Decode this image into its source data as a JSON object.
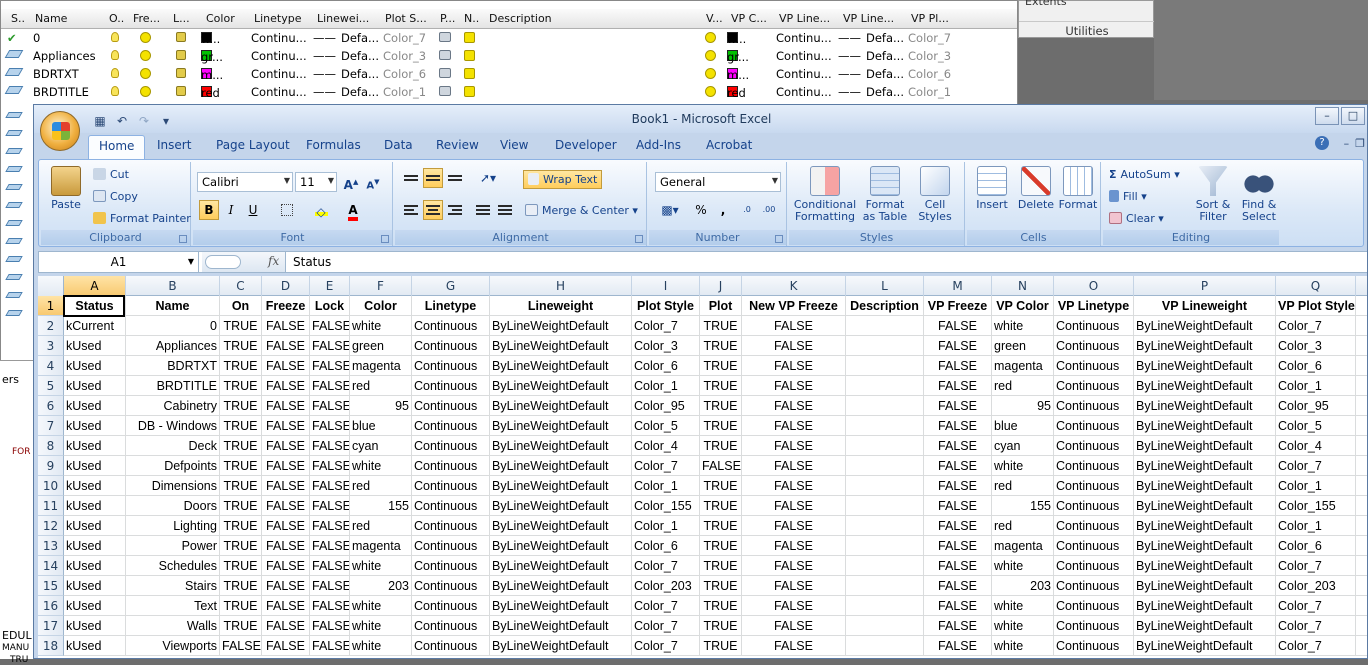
{
  "background": {
    "layer_manager": {
      "columns": [
        "S..",
        "Name",
        "O..",
        "Fre...",
        "L...",
        "Color",
        "Linetype",
        "Linewei...",
        "Plot S...",
        "P...",
        "N..",
        "Description",
        "V...",
        "VP C...",
        "VP Line...",
        "VP Line...",
        "VP Pl..."
      ],
      "rows": [
        {
          "name": "0",
          "color_label": "w...",
          "color": "#000000",
          "linetype": "Continu...",
          "lineweight": "Defa...",
          "plot_style": "Color_7",
          "vp_color_label": "w...",
          "vp_color": "#000000",
          "vp_linetype": "Continu...",
          "vp_lineweight": "Defa...",
          "vp_plot_style": "Color_7"
        },
        {
          "name": "Appliances",
          "color_label": "gr...",
          "color": "#00c000",
          "linetype": "Continu...",
          "lineweight": "Defa...",
          "plot_style": "Color_3",
          "vp_color_label": "gr...",
          "vp_color": "#00c000",
          "vp_linetype": "Continu...",
          "vp_lineweight": "Defa...",
          "vp_plot_style": "Color_3"
        },
        {
          "name": "BDRTXT",
          "color_label": "m...",
          "color": "#ff00ff",
          "linetype": "Continu...",
          "lineweight": "Defa...",
          "plot_style": "Color_6",
          "vp_color_label": "m...",
          "vp_color": "#ff00ff",
          "vp_linetype": "Continu...",
          "vp_lineweight": "Defa...",
          "vp_plot_style": "Color_6"
        },
        {
          "name": "BRDTITLE",
          "color_label": "red",
          "color": "#ff0000",
          "linetype": "Continu...",
          "lineweight": "Defa...",
          "plot_style": "Color_1",
          "vp_color_label": "red",
          "vp_color": "#ff0000",
          "vp_linetype": "Continu...",
          "vp_lineweight": "Defa...",
          "vp_plot_style": "Color_1"
        }
      ]
    },
    "utilities": {
      "extents": "Extents",
      "label": "Utilities"
    },
    "cad_text": [
      "ers",
      "FOR",
      "EDUL",
      "MANU",
      "TRU",
      "TRU"
    ]
  },
  "excel": {
    "title": "Book1 - Microsoft Excel",
    "tabs": [
      "Home",
      "Insert",
      "Page Layout",
      "Formulas",
      "Data",
      "Review",
      "View",
      "Developer",
      "Add-Ins",
      "Acrobat"
    ],
    "active_tab": "Home",
    "ribbon": {
      "clipboard": {
        "label": "Clipboard",
        "paste": "Paste",
        "cut": "Cut",
        "copy": "Copy",
        "format_painter": "Format Painter"
      },
      "font": {
        "label": "Font",
        "family": "Calibri",
        "size": "11"
      },
      "alignment": {
        "label": "Alignment",
        "wrap_text": "Wrap Text",
        "merge_center": "Merge & Center"
      },
      "number": {
        "label": "Number",
        "format": "General",
        "percent": "%",
        "comma": ","
      },
      "styles": {
        "label": "Styles",
        "conditional": "Conditional",
        "conditional2": "Formatting",
        "format_table": "Format",
        "format_table2": "as Table",
        "cell_styles": "Cell",
        "cell_styles2": "Styles"
      },
      "cells": {
        "label": "Cells",
        "insert": "Insert",
        "delete": "Delete",
        "format": "Format"
      },
      "editing": {
        "label": "Editing",
        "autosum": "AutoSum",
        "fill": "Fill",
        "clear": "Clear",
        "sort_filter": "Sort &",
        "sort_filter2": "Filter",
        "find_select": "Find &",
        "find_select2": "Select"
      }
    },
    "formula_bar": {
      "cell_ref": "A1",
      "fx": "fx",
      "content": "Status"
    },
    "sheet": {
      "column_letters": [
        "A",
        "B",
        "C",
        "D",
        "E",
        "F",
        "G",
        "H",
        "I",
        "J",
        "K",
        "L",
        "M",
        "N",
        "O",
        "P",
        "Q"
      ],
      "headers": [
        "Status",
        "Name",
        "On",
        "Freeze",
        "Lock",
        "Color",
        "Linetype",
        "Lineweight",
        "Plot Style",
        "Plot",
        "New VP Freeze",
        "Description",
        "VP Freeze",
        "VP Color",
        "VP Linetype",
        "VP Lineweight",
        "VP Plot Style"
      ],
      "rows": [
        [
          "kCurrent",
          "0",
          "TRUE",
          "FALSE",
          "FALSE",
          "white",
          "Continuous",
          "ByLineWeightDefault",
          "Color_7",
          "TRUE",
          "FALSE",
          "",
          "FALSE",
          "white",
          "Continuous",
          "ByLineWeightDefault",
          "Color_7"
        ],
        [
          "kUsed",
          "Appliances",
          "TRUE",
          "FALSE",
          "FALSE",
          "green",
          "Continuous",
          "ByLineWeightDefault",
          "Color_3",
          "TRUE",
          "FALSE",
          "",
          "FALSE",
          "green",
          "Continuous",
          "ByLineWeightDefault",
          "Color_3"
        ],
        [
          "kUsed",
          "BDRTXT",
          "TRUE",
          "FALSE",
          "FALSE",
          "magenta",
          "Continuous",
          "ByLineWeightDefault",
          "Color_6",
          "TRUE",
          "FALSE",
          "",
          "FALSE",
          "magenta",
          "Continuous",
          "ByLineWeightDefault",
          "Color_6"
        ],
        [
          "kUsed",
          "BRDTITLE",
          "TRUE",
          "FALSE",
          "FALSE",
          "red",
          "Continuous",
          "ByLineWeightDefault",
          "Color_1",
          "TRUE",
          "FALSE",
          "",
          "FALSE",
          "red",
          "Continuous",
          "ByLineWeightDefault",
          "Color_1"
        ],
        [
          "kUsed",
          "Cabinetry",
          "TRUE",
          "FALSE",
          "FALSE",
          "95",
          "Continuous",
          "ByLineWeightDefault",
          "Color_95",
          "TRUE",
          "FALSE",
          "",
          "FALSE",
          "95",
          "Continuous",
          "ByLineWeightDefault",
          "Color_95"
        ],
        [
          "kUsed",
          "DB - Windows",
          "TRUE",
          "FALSE",
          "FALSE",
          "blue",
          "Continuous",
          "ByLineWeightDefault",
          "Color_5",
          "TRUE",
          "FALSE",
          "",
          "FALSE",
          "blue",
          "Continuous",
          "ByLineWeightDefault",
          "Color_5"
        ],
        [
          "kUsed",
          "Deck",
          "TRUE",
          "FALSE",
          "FALSE",
          "cyan",
          "Continuous",
          "ByLineWeightDefault",
          "Color_4",
          "TRUE",
          "FALSE",
          "",
          "FALSE",
          "cyan",
          "Continuous",
          "ByLineWeightDefault",
          "Color_4"
        ],
        [
          "kUsed",
          "Defpoints",
          "TRUE",
          "FALSE",
          "FALSE",
          "white",
          "Continuous",
          "ByLineWeightDefault",
          "Color_7",
          "FALSE",
          "FALSE",
          "",
          "FALSE",
          "white",
          "Continuous",
          "ByLineWeightDefault",
          "Color_7"
        ],
        [
          "kUsed",
          "Dimensions",
          "TRUE",
          "FALSE",
          "FALSE",
          "red",
          "Continuous",
          "ByLineWeightDefault",
          "Color_1",
          "TRUE",
          "FALSE",
          "",
          "FALSE",
          "red",
          "Continuous",
          "ByLineWeightDefault",
          "Color_1"
        ],
        [
          "kUsed",
          "Doors",
          "TRUE",
          "FALSE",
          "FALSE",
          "155",
          "Continuous",
          "ByLineWeightDefault",
          "Color_155",
          "TRUE",
          "FALSE",
          "",
          "FALSE",
          "155",
          "Continuous",
          "ByLineWeightDefault",
          "Color_155"
        ],
        [
          "kUsed",
          "Lighting",
          "TRUE",
          "FALSE",
          "FALSE",
          "red",
          "Continuous",
          "ByLineWeightDefault",
          "Color_1",
          "TRUE",
          "FALSE",
          "",
          "FALSE",
          "red",
          "Continuous",
          "ByLineWeightDefault",
          "Color_1"
        ],
        [
          "kUsed",
          "Power",
          "TRUE",
          "FALSE",
          "FALSE",
          "magenta",
          "Continuous",
          "ByLineWeightDefault",
          "Color_6",
          "TRUE",
          "FALSE",
          "",
          "FALSE",
          "magenta",
          "Continuous",
          "ByLineWeightDefault",
          "Color_6"
        ],
        [
          "kUsed",
          "Schedules",
          "TRUE",
          "FALSE",
          "FALSE",
          "white",
          "Continuous",
          "ByLineWeightDefault",
          "Color_7",
          "TRUE",
          "FALSE",
          "",
          "FALSE",
          "white",
          "Continuous",
          "ByLineWeightDefault",
          "Color_7"
        ],
        [
          "kUsed",
          "Stairs",
          "TRUE",
          "FALSE",
          "FALSE",
          "203",
          "Continuous",
          "ByLineWeightDefault",
          "Color_203",
          "TRUE",
          "FALSE",
          "",
          "FALSE",
          "203",
          "Continuous",
          "ByLineWeightDefault",
          "Color_203"
        ],
        [
          "kUsed",
          "Text",
          "TRUE",
          "FALSE",
          "FALSE",
          "white",
          "Continuous",
          "ByLineWeightDefault",
          "Color_7",
          "TRUE",
          "FALSE",
          "",
          "FALSE",
          "white",
          "Continuous",
          "ByLineWeightDefault",
          "Color_7"
        ],
        [
          "kUsed",
          "Walls",
          "TRUE",
          "FALSE",
          "FALSE",
          "white",
          "Continuous",
          "ByLineWeightDefault",
          "Color_7",
          "TRUE",
          "FALSE",
          "",
          "FALSE",
          "white",
          "Continuous",
          "ByLineWeightDefault",
          "Color_7"
        ],
        [
          "kUsed",
          "Viewports",
          "FALSE",
          "FALSE",
          "FALSE",
          "white",
          "Continuous",
          "ByLineWeightDefault",
          "Color_7",
          "TRUE",
          "FALSE",
          "",
          "FALSE",
          "white",
          "Continuous",
          "ByLineWeightDefault",
          "Color_7"
        ]
      ]
    }
  }
}
